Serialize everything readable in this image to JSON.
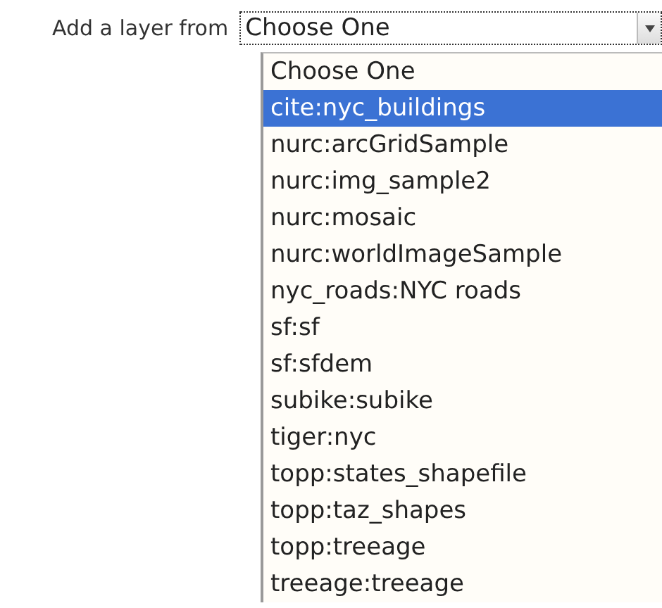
{
  "label": "Add a layer from",
  "select": {
    "value": "Choose One"
  },
  "options": [
    {
      "label": "Choose One",
      "selected": false
    },
    {
      "label": "cite:nyc_buildings",
      "selected": true
    },
    {
      "label": "nurc:arcGridSample",
      "selected": false
    },
    {
      "label": "nurc:img_sample2",
      "selected": false
    },
    {
      "label": "nurc:mosaic",
      "selected": false
    },
    {
      "label": "nurc:worldImageSample",
      "selected": false
    },
    {
      "label": "nyc_roads:NYC roads",
      "selected": false
    },
    {
      "label": "sf:sf",
      "selected": false
    },
    {
      "label": "sf:sfdem",
      "selected": false
    },
    {
      "label": "subike:subike",
      "selected": false
    },
    {
      "label": "tiger:nyc",
      "selected": false
    },
    {
      "label": "topp:states_shapefile",
      "selected": false
    },
    {
      "label": "topp:taz_shapes",
      "selected": false
    },
    {
      "label": "topp:treeage",
      "selected": false
    },
    {
      "label": "treeage:treeage",
      "selected": false
    }
  ]
}
